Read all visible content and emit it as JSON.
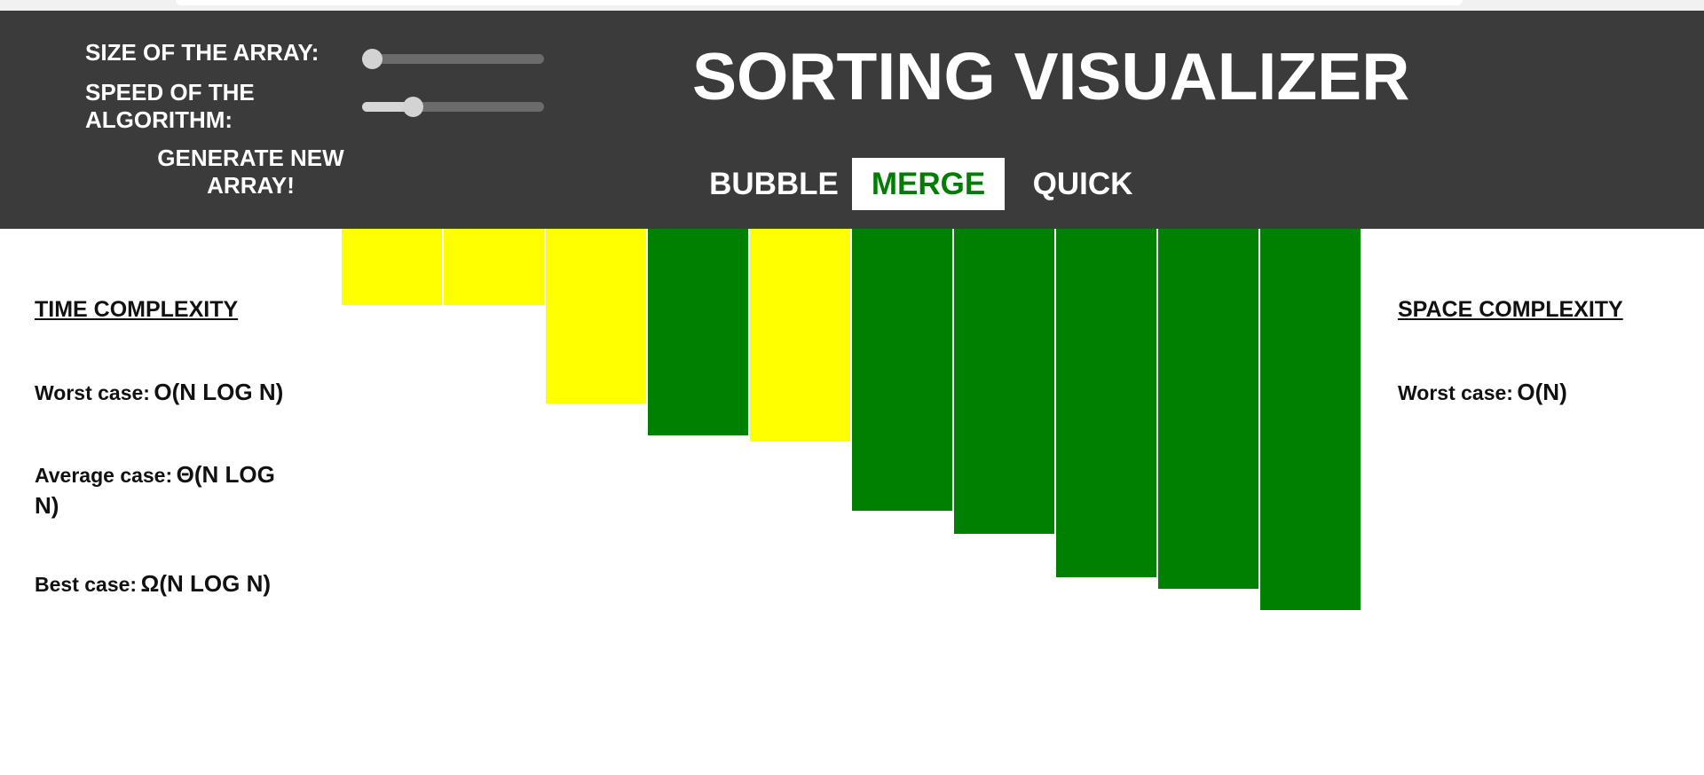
{
  "colors": {
    "header_bg": "#3b3b3b",
    "bar_compare": "#ffff00",
    "bar_sorted": "#008000",
    "active_tab_text": "#047b04"
  },
  "controls": {
    "size_label": "SIZE OF THE ARRAY:",
    "size_value": 0,
    "speed_label": "SPEED OF THE ALGORITHM:",
    "speed_value": 0.25,
    "generate_label": "GENERATE NEW ARRAY!"
  },
  "header": {
    "title": "SORTING VISUALIZER"
  },
  "algorithms": [
    {
      "label": "BUBBLE",
      "active": false
    },
    {
      "label": "MERGE",
      "active": true
    },
    {
      "label": "QUICK",
      "active": false
    }
  ],
  "array_bars": [
    {
      "value": 86,
      "state": "compare"
    },
    {
      "value": 86,
      "state": "compare"
    },
    {
      "value": 197,
      "state": "compare"
    },
    {
      "value": 233,
      "state": "sorted"
    },
    {
      "value": 240,
      "state": "compare"
    },
    {
      "value": 318,
      "state": "sorted"
    },
    {
      "value": 344,
      "state": "sorted"
    },
    {
      "value": 393,
      "state": "sorted"
    },
    {
      "value": 406,
      "state": "sorted"
    },
    {
      "value": 430,
      "state": "sorted"
    }
  ],
  "time_complexity": {
    "heading": "TIME COMPLEXITY",
    "worst_label": "Worst case:",
    "worst_value": "O(N LOG N)",
    "average_label": "Average case:",
    "average_value": "Θ(N LOG N)",
    "best_label": "Best case:",
    "best_value": "Ω(N LOG N)"
  },
  "space_complexity": {
    "heading": "SPACE COMPLEXITY",
    "worst_label": "Worst case:",
    "worst_value": "O(N)"
  }
}
